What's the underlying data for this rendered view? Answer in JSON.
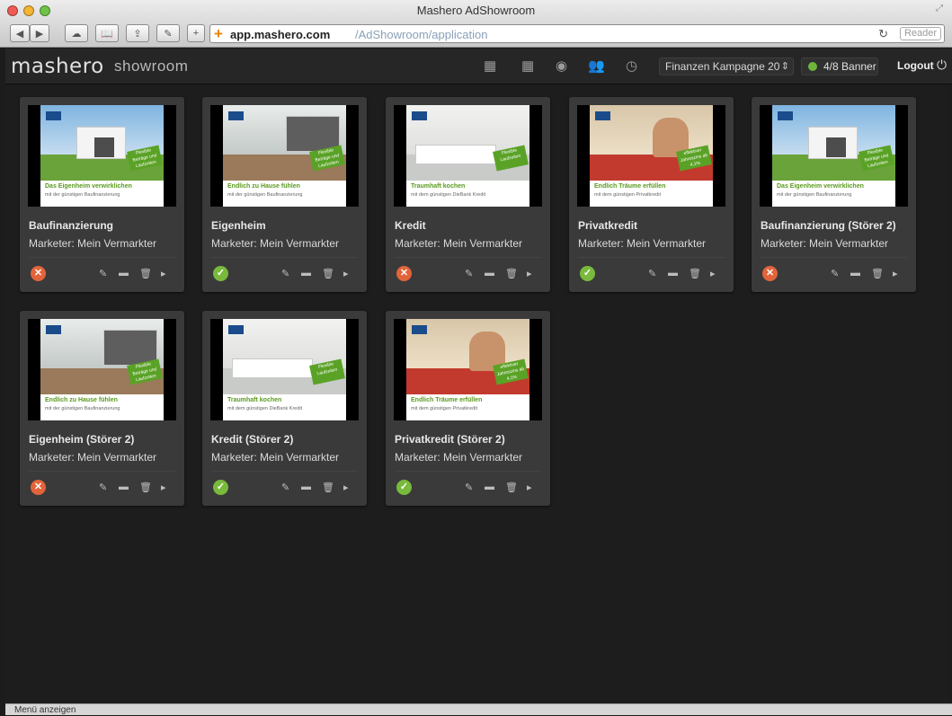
{
  "window": {
    "title": "Mashero AdShowroom"
  },
  "browser": {
    "url_domain": "app.mashero.com",
    "url_path": "/AdShowroom/application",
    "reader_label": "Reader"
  },
  "header": {
    "logo": "mashero",
    "logo_sub": "showroom",
    "campaign": "Finanzen Kampagne 20",
    "banner_count": "4/8 Banner",
    "logout_label": "Logout",
    "icons": [
      "grid-add-icon",
      "grid-edit-icon",
      "eye-icon",
      "users-icon",
      "clock-icon"
    ]
  },
  "colors": {
    "accent_green": "#79b93c",
    "reject_orange": "#e2643a",
    "background": "#1d1d1d",
    "card": "#3a3a3a"
  },
  "cards": [
    {
      "name": "Baufinanzierung",
      "marketer": "Marketer: Mein Vermarkter",
      "status": "rejected",
      "ad_title": "Das Eigenheim verwirklichen",
      "ad_sub": "mit der günstigen Baufinanzierung",
      "badge": "Flexible Beträge und Laufzeiten",
      "scene": "house"
    },
    {
      "name": "Eigenheim",
      "marketer": "Marketer: Mein Vermarkter",
      "status": "approved",
      "ad_title": "Endlich zu Hause fühlen",
      "ad_sub": "mit der günstigen Baufinanzierung",
      "badge": "Flexible Beträge und Laufzeiten",
      "scene": "interior"
    },
    {
      "name": "Kredit",
      "marketer": "Marketer: Mein Vermarkter",
      "status": "rejected",
      "ad_title": "Traumhaft kochen",
      "ad_sub": "mit dem günstigen DieBank Kredit",
      "badge": "Flexible Laufzeiten",
      "scene": "kitchen"
    },
    {
      "name": "Privatkredit",
      "marketer": "Marketer: Mein Vermarkter",
      "status": "approved",
      "ad_title": "Endlich Träume erfüllen",
      "ad_sub": "mit dem günstigen Privatkredit",
      "badge": "effektiver Jahreszins ab 4,1%",
      "scene": "car"
    },
    {
      "name": "Baufinanzierung (Störer 2)",
      "marketer": "Marketer: Mein Vermarkter",
      "status": "rejected",
      "ad_title": "Das Eigenheim verwirklichen",
      "ad_sub": "mit der günstigen Baufinanzierung",
      "badge": "Flexible Beträge und Laufzeiten",
      "scene": "house"
    },
    {
      "name": "Eigenheim (Störer 2)",
      "marketer": "Marketer: Mein Vermarkter",
      "status": "rejected",
      "ad_title": "Endlich zu Hause fühlen",
      "ad_sub": "mit der günstigen Baufinanzierung",
      "badge": "Flexible Beträge und Laufzeiten",
      "scene": "interior"
    },
    {
      "name": "Kredit (Störer 2)",
      "marketer": "Marketer: Mein Vermarkter",
      "status": "approved",
      "ad_title": "Traumhaft kochen",
      "ad_sub": "mit dem günstigen DieBank Kredit",
      "badge": "Flexible Laufzeiten",
      "scene": "kitchen"
    },
    {
      "name": "Privatkredit (Störer 2)",
      "marketer": "Marketer: Mein Vermarkter",
      "status": "approved",
      "ad_title": "Endlich Träume erfüllen",
      "ad_sub": "mit dem günstigen Privatkredit",
      "badge": "effektiver Jahreszins ab 4,1%",
      "scene": "car"
    }
  ],
  "card_action_icons": [
    "tag-icon",
    "comment-icon",
    "trash-icon",
    "arrow-right-icon"
  ],
  "statusbar": {
    "menu_label": "Menü anzeigen"
  }
}
